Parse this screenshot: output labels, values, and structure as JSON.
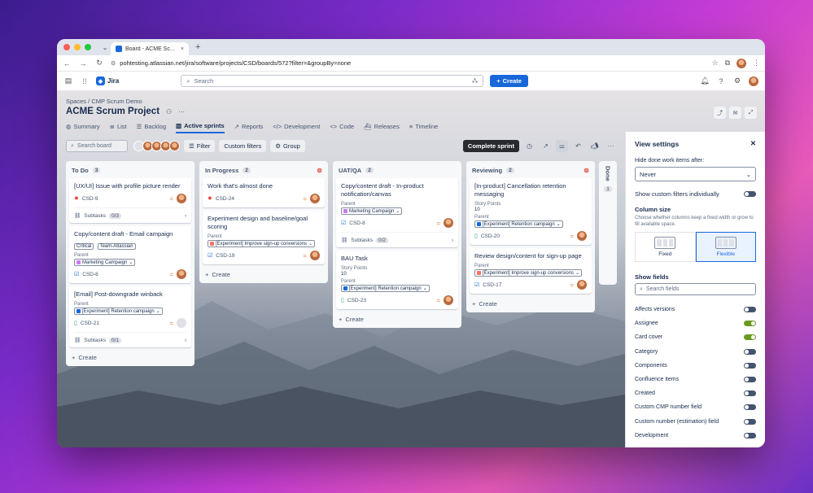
{
  "browser": {
    "tab_title": "Board - ACME Scrum Project",
    "url": "pohtesting.atlassian.net/jira/software/projects/CSD/boards/572?filter=&groupBy=none"
  },
  "jira": {
    "app_name": "Jira",
    "search_placeholder": "Search",
    "create_label": "Create"
  },
  "page": {
    "breadcrumb": [
      "Spaces",
      "/",
      "CMP Scrum Demo"
    ],
    "title": "ACME Scrum Project",
    "nav_tabs": [
      {
        "label": "Summary",
        "icon": "globe-icon"
      },
      {
        "label": "List",
        "icon": "list-icon"
      },
      {
        "label": "Backlog",
        "icon": "backlog-icon"
      },
      {
        "label": "Active sprints",
        "icon": "board-icon",
        "active": true
      },
      {
        "label": "Reports",
        "icon": "chart-icon"
      },
      {
        "label": "Development",
        "icon": "code-icon"
      },
      {
        "label": "Code",
        "icon": "code-icon"
      },
      {
        "label": "Releases",
        "icon": "ship-icon"
      },
      {
        "label": "Timeline",
        "icon": "timeline-icon"
      }
    ]
  },
  "toolbar": {
    "search_placeholder": "Search board",
    "filter_label": "Filter",
    "custom_filters_label": "Custom filters",
    "group_label": "Group",
    "complete_sprint_label": "Complete sprint"
  },
  "columns": {
    "todo": {
      "name": "To Do",
      "count": "3",
      "cards": {
        "c1": {
          "title": "[UX/UI] Issue with profile picture render",
          "key": "CSD-9",
          "subtasks_label": "Subtasks",
          "subtasks_count": "0/3"
        },
        "c2": {
          "title": "Copy/content draft - Email campaign",
          "tags": [
            "Critical",
            "Team-Atlassian"
          ],
          "parent_label": "Parent",
          "parent": "Marketing Campaign",
          "key": "CSD-6"
        },
        "c3": {
          "title": "[Email] Post-downgrade winback",
          "parent_label": "Parent",
          "parent": "[Experiment] Retention campaign",
          "key": "CSD-21",
          "subtasks_label": "Subtasks",
          "subtasks_count": "0/1"
        }
      },
      "create_label": "Create"
    },
    "inprogress": {
      "name": "In Progress",
      "count": "2",
      "cards": {
        "c1": {
          "title": "Work that's almost done",
          "key": "CSD-24"
        },
        "c2": {
          "title": "Experiment design and baseline/goal scoring",
          "parent_label": "Parent",
          "parent": "[Experiment] Improve sign-up conversions",
          "key": "CSD-19"
        }
      },
      "create_label": "Create"
    },
    "uatqa": {
      "name": "UAT/QA",
      "count": "2",
      "cards": {
        "c1": {
          "title": "Copy/content draft - In-product notification/canvas",
          "parent_label": "Parent",
          "parent": "Marketing Campaign",
          "key": "CSD-8",
          "subtasks_label": "Subtasks",
          "subtasks_count": "0/2"
        },
        "c2": {
          "title": "BAU Task",
          "sp_label": "Story Points",
          "sp": "10",
          "parent_label": "Parent",
          "parent": "[Experiment] Retention campaign",
          "key": "CSD-23"
        }
      },
      "create_label": "Create"
    },
    "reviewing": {
      "name": "Reviewing",
      "count": "2",
      "cards": {
        "c1": {
          "title": "[In-product] Cancellation retention messaging",
          "sp_label": "Story Points",
          "sp": "10",
          "parent_label": "Parent",
          "parent": "[Experiment] Retention campaign",
          "key": "CSD-20"
        },
        "c2": {
          "title": "Review design/content for sign-up page",
          "parent_label": "Parent",
          "parent": "[Experiment] Improve sign-up conversions",
          "key": "CSD-17"
        }
      },
      "create_label": "Create"
    },
    "done": {
      "name": "Done",
      "count": "1"
    }
  },
  "view_settings": {
    "title": "View settings",
    "hide_done_label": "Hide done work items after:",
    "hide_done_value": "Never",
    "custom_filters_label": "Show custom filters individually",
    "column_size_title": "Column size",
    "column_size_desc": "Choose whether columns keep a fixed width or grow to fill available space.",
    "fixed_label": "Fixed",
    "flexible_label": "Flexible",
    "show_fields_title": "Show fields",
    "search_fields_placeholder": "Search fields",
    "fields": [
      {
        "label": "Affects versions",
        "on": false
      },
      {
        "label": "Assignee",
        "on": true
      },
      {
        "label": "Card cover",
        "on": true
      },
      {
        "label": "Category",
        "on": false
      },
      {
        "label": "Components",
        "on": false
      },
      {
        "label": "Confluence items",
        "on": false
      },
      {
        "label": "Created",
        "on": false
      },
      {
        "label": "Custom CMP number field",
        "on": false
      },
      {
        "label": "Custom number (estimation) field",
        "on": false
      },
      {
        "label": "Development",
        "on": false
      }
    ]
  },
  "colors": {
    "accent": "#1868db",
    "priority": "#e2843d",
    "bug": "#e2483d",
    "marketing_chip": "#c97cf4",
    "retention_chip": "#1868db",
    "signup_chip": "#f87462"
  }
}
